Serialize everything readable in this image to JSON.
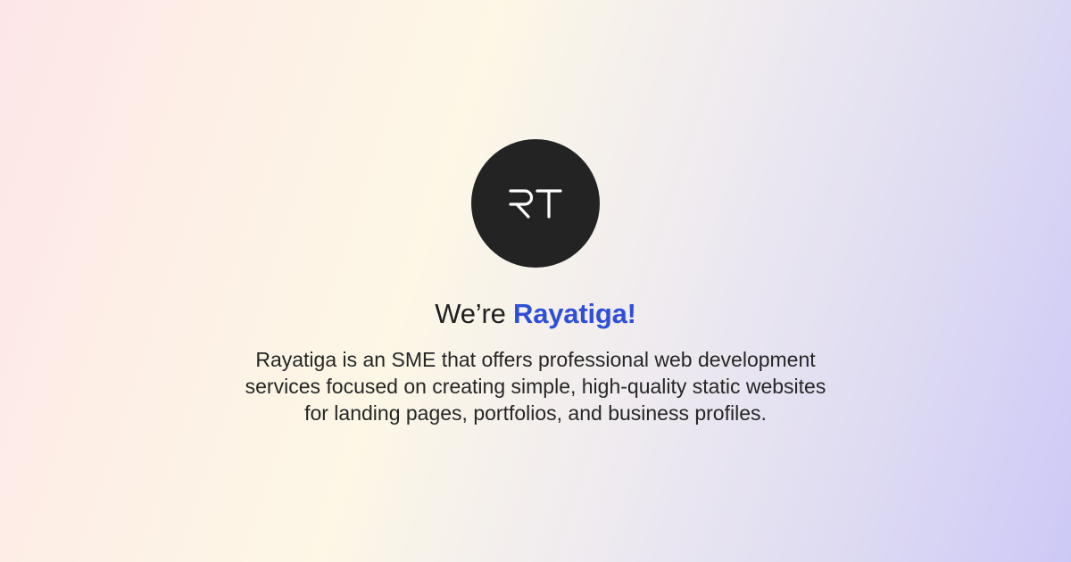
{
  "logo": {
    "monogram": "RT",
    "background_color": "#232323",
    "letter_color": "#ffffff"
  },
  "headline": {
    "prefix": "We’re ",
    "brand": "Rayatiga!",
    "brand_color": "#2f4fd6"
  },
  "description": {
    "lines": [
      "Rayatiga is an SME that offers professional web development",
      "services focused on creating simple, high-quality static websites",
      "for landing pages, portfolios, and business profiles."
    ]
  }
}
